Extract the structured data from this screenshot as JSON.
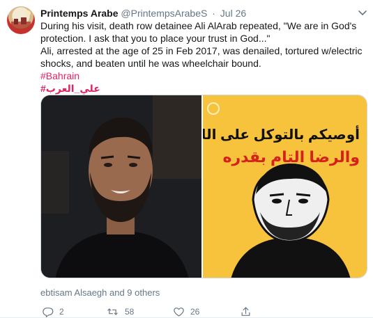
{
  "tweet": {
    "author_name": "Printemps Arabe",
    "author_handle": "@PrintempsArabeS",
    "separator": "·",
    "timestamp": "Jul 26",
    "text_line_1": "During his visit, death row detainee Ali AlArab repeated, \"We are in God's protection. I ask that you to place your trust in God...\"",
    "text_line_2": "Ali, arrested at the age of 25 in Feb 2017, was denailed, tortured w/electric shocks, and beaten until he was wheelchair bound.",
    "hashtag_1": "#Bahrain",
    "hashtag_2": "#علي_العرب",
    "media": {
      "right_image_text_line_1": "أوصيكم بالتوكل على الله",
      "right_image_text_line_2": "والرضا التام بقدره"
    },
    "liked_by": "ebtisam Alsaegh and 9 others",
    "actions": {
      "reply_count": "2",
      "retweet_count": "58",
      "like_count": "26"
    }
  },
  "colors": {
    "hashtag": "#e0245e",
    "secondary_text": "#657786",
    "poster_background": "#f7c33d",
    "poster_accent": "#d6201a"
  },
  "icons": [
    "chevron-down-icon",
    "reply-icon",
    "retweet-icon",
    "like-icon",
    "share-icon"
  ]
}
